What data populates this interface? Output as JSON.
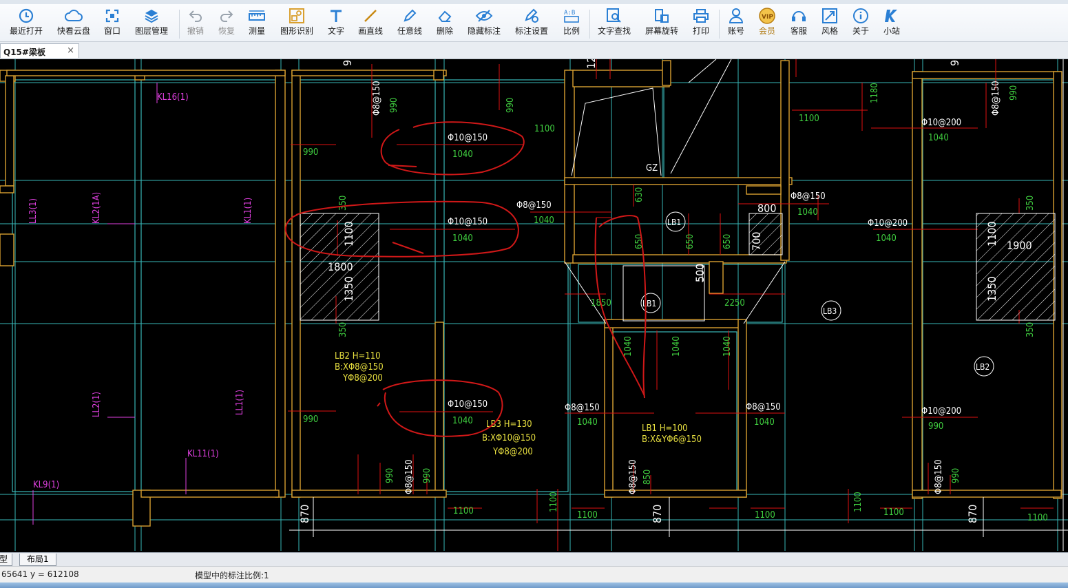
{
  "toolbar": {
    "items": [
      {
        "label": "最近打开",
        "icon": "recent-open-icon"
      },
      {
        "label": "快看云盘",
        "icon": "cloud-icon"
      },
      {
        "label": "窗口",
        "icon": "window-icon"
      },
      {
        "label": "图层管理",
        "icon": "layers-icon"
      },
      {
        "label": "撤销",
        "icon": "undo-icon"
      },
      {
        "label": "恢复",
        "icon": "redo-icon"
      },
      {
        "label": "测量",
        "icon": "ruler-icon"
      },
      {
        "label": "图形识别",
        "icon": "shape-recognize-icon"
      },
      {
        "label": "文字",
        "icon": "text-icon"
      },
      {
        "label": "画直线",
        "icon": "line-icon"
      },
      {
        "label": "任意线",
        "icon": "pencil-icon"
      },
      {
        "label": "删除",
        "icon": "eraser-icon"
      },
      {
        "label": "隐藏标注",
        "icon": "hide-eye-icon"
      },
      {
        "label": "标注设置",
        "icon": "annotation-settings-icon"
      },
      {
        "label": "比例",
        "icon": "scale-icon"
      },
      {
        "label": "文字查找",
        "icon": "text-search-icon"
      },
      {
        "label": "屏幕旋转",
        "icon": "rotate-screen-icon"
      },
      {
        "label": "打印",
        "icon": "printer-icon"
      },
      {
        "label": "账号",
        "icon": "account-icon"
      },
      {
        "label": "会员",
        "icon": "vip-icon"
      },
      {
        "label": "客服",
        "icon": "headset-icon"
      },
      {
        "label": "风格",
        "icon": "style-icon"
      },
      {
        "label": "关于",
        "icon": "info-icon"
      },
      {
        "label": "小站",
        "icon": "k-logo-icon"
      }
    ],
    "colors": {
      "icon_blue": "#2a7fd4",
      "vip_gold": "#c98a14"
    }
  },
  "tabs": {
    "doc_title": "Q15#梁板",
    "close": "×"
  },
  "layout_tabs": {
    "model": "型",
    "layout1": "布局1"
  },
  "status": {
    "coords": "65641 y = 612108",
    "scale_text": "模型中的标注比例:1"
  },
  "drawing": {
    "colors": {
      "background": "#000000",
      "wall": "#d9a030",
      "grid": "#38b8b8",
      "magenta": "#e040e0",
      "green": "#40d040",
      "yellow": "#e8e040",
      "white": "#ffffff",
      "red": "#e01010",
      "markup": "#d01818"
    },
    "beam_labels": [
      "KL16(1)",
      "LL3(1)",
      "KL2(1A)",
      "KL1(1)",
      "LL2(1)",
      "LL1(1)",
      "KL11(1)",
      "KL9(1)"
    ],
    "rebar_labels": [
      "Φ8@150",
      "Φ10@150",
      "Φ10@150",
      "Φ8@150",
      "Φ8@150",
      "Φ10@200",
      "Φ10@200",
      "Φ10@150",
      "Φ8@150",
      "Φ8@150",
      "Φ10@200",
      "Φ8@150",
      "Φ8@150",
      "Φ8@150",
      "Φ8@150",
      "Φ10@150"
    ],
    "dims_green": [
      "990",
      "990",
      "1100",
      "990",
      "1040",
      "1040",
      "1180",
      "1100",
      "1040",
      "1040",
      "1040",
      "1040",
      "350",
      "350",
      "630",
      "650",
      "650",
      "650",
      "1040",
      "1040",
      "1040",
      "1850",
      "2250",
      "990",
      "990",
      "990",
      "1040",
      "1040",
      "1100",
      "1100",
      "1100",
      "1100",
      "1100",
      "1100",
      "1100",
      "1040",
      "850",
      "350",
      "350",
      "990",
      "990",
      "990"
    ],
    "dims_white": [
      "1100",
      "1800",
      "1350",
      "800",
      "700",
      "500",
      "1100",
      "1900",
      "1350",
      "870",
      "870",
      "870",
      "9",
      "12",
      "9"
    ],
    "slab_tags": [
      "LB1",
      "LB1",
      "LB3",
      "LB2"
    ],
    "gz": "GZ",
    "slab_notes": [
      {
        "l1": "LB2  H=110",
        "l2": "B:XΦ8@150",
        "l3": "YΦ8@200"
      },
      {
        "l1": "LB3  H=130",
        "l2": "B:XΦ10@150",
        "l3": "YΦ8@200"
      },
      {
        "l1": "LB1  H=100",
        "l2": "B:X&YΦ6@150"
      }
    ]
  }
}
